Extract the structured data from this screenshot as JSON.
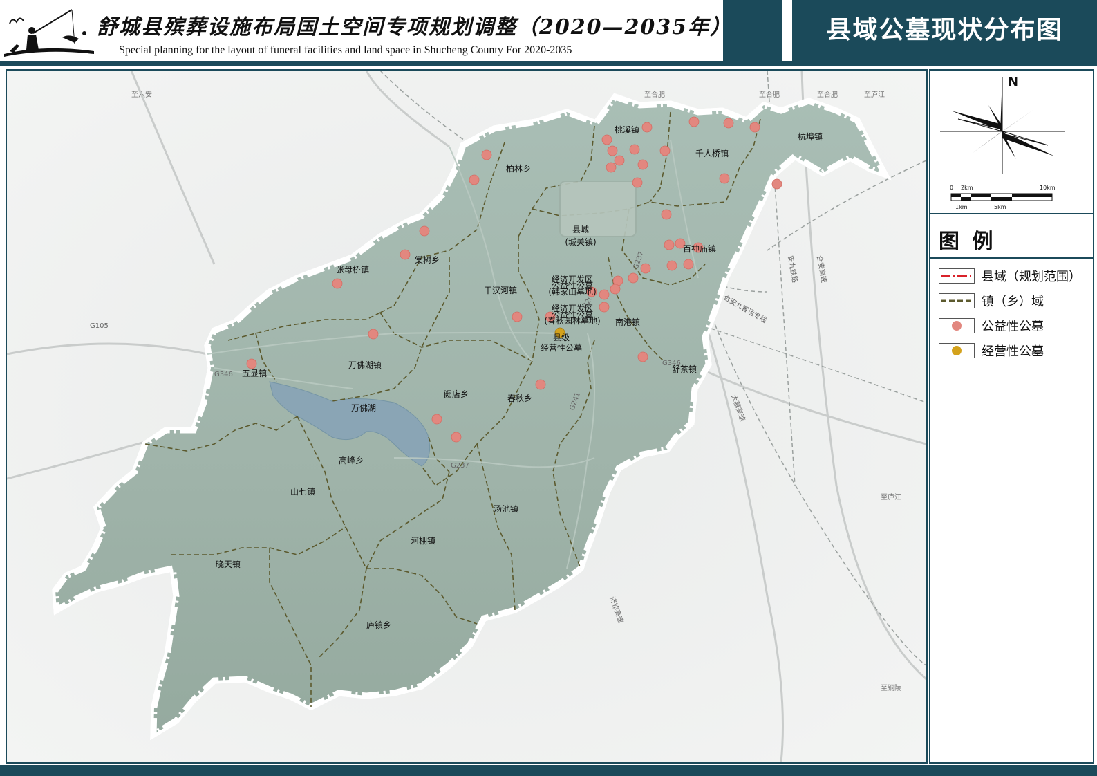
{
  "header": {
    "title_cn": "舒城县殡葬设施布局国土空间专项规划调整（2020—2035年）",
    "title_en": "Special planning for the layout of funeral facilities and land space in Shucheng County For 2020-2035",
    "map_title": "县域公墓现状分布图"
  },
  "compass": {
    "north": "N"
  },
  "scalebar": {
    "top_labels": [
      "0",
      "2km",
      "10km"
    ],
    "bottom_labels": [
      "1km",
      "5km"
    ]
  },
  "legend": {
    "title": "图 例",
    "items": [
      {
        "label": "县域（规划范围）",
        "kind": "boundary",
        "color": "#d9222a"
      },
      {
        "label": "镇（乡）域",
        "kind": "town",
        "color": "#5c5a2e"
      },
      {
        "label": "公益性公墓",
        "kind": "public",
        "color": "#e2877f"
      },
      {
        "label": "经营性公墓",
        "kind": "commercial",
        "color": "#d4a21c"
      }
    ]
  },
  "map": {
    "towns": [
      {
        "name": "桃溪镇"
      },
      {
        "name": "杭埠镇"
      },
      {
        "name": "千人桥镇"
      },
      {
        "name": "柏林乡"
      },
      {
        "name": "县城"
      },
      {
        "name": "(城关镇)"
      },
      {
        "name": "棠树乡"
      },
      {
        "name": "张母桥镇"
      },
      {
        "name": "百神庙镇"
      },
      {
        "name": "干汉河镇"
      },
      {
        "name": "南港镇"
      },
      {
        "name": "五显镇"
      },
      {
        "name": "万佛湖镇"
      },
      {
        "name": "舒茶镇"
      },
      {
        "name": "阙店乡"
      },
      {
        "name": "春秋乡"
      },
      {
        "name": "万佛湖"
      },
      {
        "name": "高峰乡"
      },
      {
        "name": "山七镇"
      },
      {
        "name": "汤池镇"
      },
      {
        "name": "河棚镇"
      },
      {
        "name": "晓天镇"
      },
      {
        "name": "庐镇乡"
      }
    ],
    "facility_labels": [
      {
        "lines": [
          "经济开发区",
          "公益性公墓",
          "(韩家山墓地)"
        ]
      },
      {
        "lines": [
          "经济开发区",
          "公益性公墓",
          "(春秋园林墓地)"
        ]
      },
      {
        "lines": [
          "县级",
          "经营性公墓"
        ]
      }
    ],
    "directions": [
      "至六安",
      "至合肥",
      "至合肥",
      "至合肥",
      "至庐江",
      "至庐江",
      "至铜陵"
    ],
    "roads": [
      "G105",
      "G346",
      "G346",
      "G206",
      "G237",
      "G241",
      "G237"
    ],
    "road_names": [
      "安九铁路",
      "合安高速",
      "合安九客运专线",
      "大墓高速",
      "济祁高速"
    ],
    "cemeteries": {
      "public_count": 40,
      "commercial_count": 1
    }
  }
}
